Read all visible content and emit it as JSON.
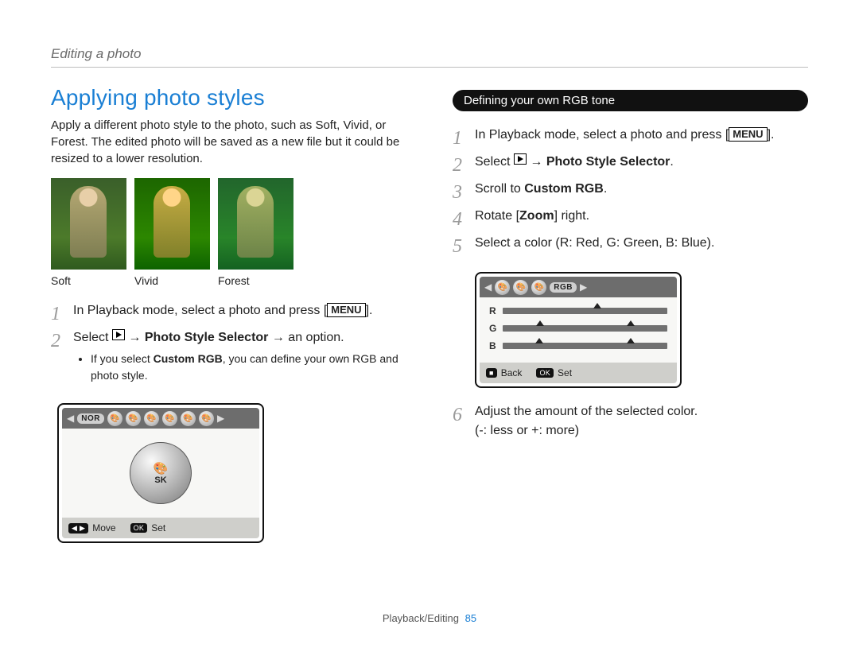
{
  "breadcrumb": "Editing a photo",
  "title": "Applying photo styles",
  "intro": "Apply a different photo style to the photo, such as Soft, Vivid, or Forest. The edited photo will be saved as a new file but it could be resized to a lower resolution.",
  "thumbs": {
    "soft": "Soft",
    "vivid": "Vivid",
    "forest": "Forest"
  },
  "left_steps": {
    "s1_a": "In Playback mode, select a photo and press [",
    "s1_b": "].",
    "menu_label": "MENU",
    "s2_a": "Select ",
    "s2_b": " → ",
    "s2_psel": "Photo Style Selector",
    "s2_c": " → an option.",
    "sub_a": "If you select ",
    "sub_bold": "Custom RGB",
    "sub_b": ", you can define your own RGB and photo style."
  },
  "device_left": {
    "nor": "NOR",
    "sk": "SK",
    "move": "Move",
    "set": "Set",
    "ok": "OK",
    "arrows": "◀ ▶"
  },
  "right_heading": "Defining your own RGB tone",
  "right_steps": {
    "s1_a": "In Playback mode, select a photo and press [",
    "s1_b": "].",
    "s2_a": "Select ",
    "s2_b": " → ",
    "s2_psel": "Photo Style Selector",
    "s2_c": ".",
    "s3_a": "Scroll to ",
    "s3_bold": "Custom RGB",
    "s3_b": ".",
    "s4_a": "Rotate [",
    "s4_bold": "Zoom",
    "s4_b": "] right.",
    "s5": "Select a color (R: Red, G: Green, B: Blue).",
    "s6_line1": "Adjust the amount of the selected color.",
    "s6_line2": "(-: less or +: more)"
  },
  "device_right": {
    "rgb": "RGB",
    "r": "R",
    "g": "G",
    "b": "B",
    "back": "Back",
    "set": "Set",
    "ok": "OK",
    "stop": "■"
  },
  "footer": {
    "section": "Playback/Editing",
    "page": "85"
  }
}
